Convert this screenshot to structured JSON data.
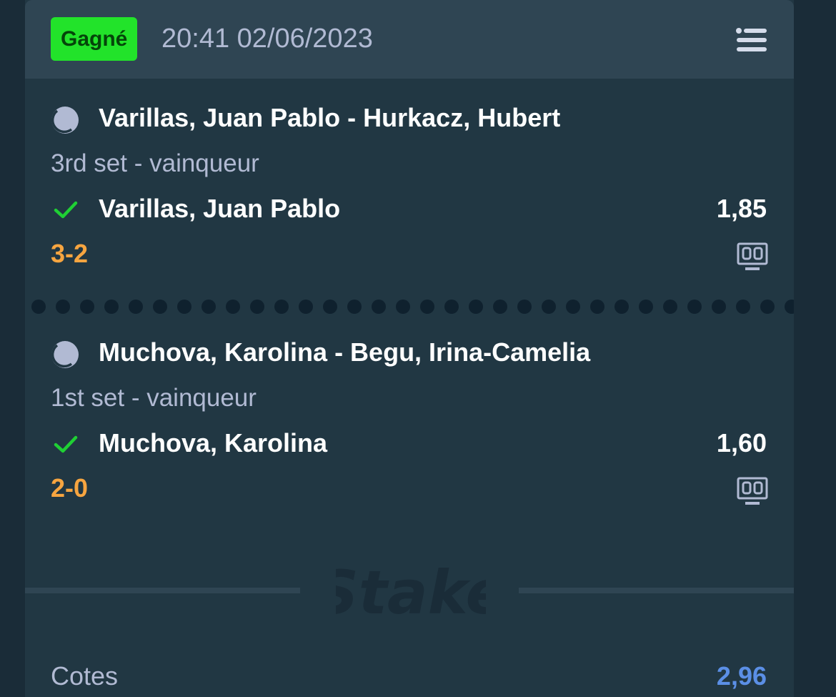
{
  "ticket": {
    "status": "Gagné",
    "datetime": "20:41 02/06/2023",
    "menu_icon": "menu-icon"
  },
  "bets": [
    {
      "sport_icon": "tennis-ball-icon",
      "event": "Varillas, Juan Pablo - Hurkacz, Hubert",
      "market": "3rd set - vainqueur",
      "result_icon": "check-icon",
      "selection": "Varillas, Juan Pablo",
      "odds": "1,85",
      "score": "3-2",
      "score_icon": "scoreboard-icon"
    },
    {
      "sport_icon": "tennis-ball-icon",
      "event": "Muchova, Karolina - Begu, Irina-Camelia",
      "market": "1st set - vainqueur",
      "result_icon": "check-icon",
      "selection": "Muchova, Karolina",
      "odds": "1,60",
      "score": "2-0",
      "score_icon": "scoreboard-icon"
    }
  ],
  "watermark": "Stake",
  "summary": {
    "odds_label": "Cotes",
    "odds_value": "2,96"
  },
  "colors": {
    "background": "#1a2c38",
    "card": "#213743",
    "header": "#2f4553",
    "win_badge": "#22e32a",
    "check": "#1fd034",
    "score": "#f7a540",
    "total_odds": "#5b8fe6",
    "muted_text": "#b1bad3"
  }
}
